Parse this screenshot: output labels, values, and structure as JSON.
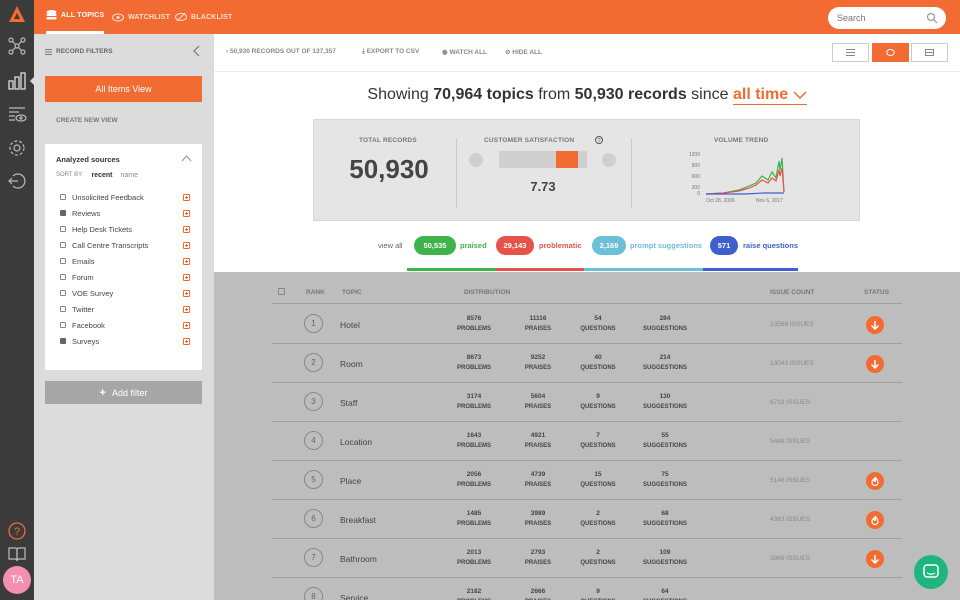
{
  "topbar": {
    "nav": [
      "ALL TOPICS",
      "WATCHLIST",
      "BLACKLIST"
    ],
    "search_placeholder": "Search"
  },
  "sidebar": {
    "avatar_initials": "TA",
    "icons": [
      "nodes-icon",
      "bar-chart-icon",
      "watch-list-icon",
      "gear-icon",
      "logout-icon",
      "help-icon",
      "book-icon"
    ]
  },
  "filters": {
    "header": "RECORD FILTERS",
    "all_items": "All Items View",
    "create_view": "CREATE NEW VIEW",
    "sources_title": "Analyzed sources",
    "sort_by": "SORT BY:",
    "sort_recent": "recent",
    "sort_name": "name",
    "sources": [
      {
        "label": "Unsolicited Feedback",
        "checked": false
      },
      {
        "label": "Reviews",
        "checked": true
      },
      {
        "label": "Help Desk Tickets",
        "checked": false
      },
      {
        "label": "Call Centre Transcripts",
        "checked": false
      },
      {
        "label": "Emails",
        "checked": false
      },
      {
        "label": "Forum",
        "checked": false
      },
      {
        "label": "VOE Survey",
        "checked": false
      },
      {
        "label": "Twitter",
        "checked": false
      },
      {
        "label": "Facebook",
        "checked": false
      },
      {
        "label": "Surveys",
        "checked": true
      }
    ],
    "add_filter": "Add filter"
  },
  "toolbar": {
    "records": "50,930 RECORDS OUT OF 137,357",
    "export": "EXPORT TO CSV",
    "watch_all": "WATCH ALL",
    "hide_all": "HIDE ALL"
  },
  "headline": {
    "prefix": "Showing",
    "topics": "70,964 topics",
    "from": "from",
    "records": "50,930 records",
    "since": "since",
    "period": "all time"
  },
  "stats": {
    "total_label": "TOTAL RECORDS",
    "total_value": "50,930",
    "csat_label": "CUSTOMER SATISFACTION",
    "csat_value": "7.73",
    "csat_level": 0.773,
    "trend_label": "VOLUME TREND",
    "trend_y_ticks": [
      "1200",
      "900",
      "600",
      "300",
      "0"
    ],
    "trend_x_ticks": [
      "Oct 28, 2006",
      "Nov 6, 2017"
    ]
  },
  "pills": {
    "view_all": "view all",
    "items": [
      {
        "value": "50,535",
        "label": "praised",
        "color": "#3db34a"
      },
      {
        "value": "29,143",
        "label": "problematic",
        "color": "#e5534b"
      },
      {
        "value": "2,169",
        "label": "prompt suggestions",
        "color": "#6bbfd6"
      },
      {
        "value": "571",
        "label": "raise questions",
        "color": "#3f5fcf"
      }
    ]
  },
  "table": {
    "headers": {
      "rank": "RANK",
      "topic": "TOPIC",
      "distribution": "DISTRIBUTION",
      "issue_count": "ISSUE COUNT",
      "status": "STATUS"
    },
    "dist_labels": [
      "PROBLEMS",
      "PRAISES",
      "QUESTIONS",
      "SUGGESTIONS"
    ],
    "rows": [
      {
        "rank": "1",
        "topic": "Hotel",
        "problems": "8576",
        "praises": "11116",
        "questions": "54",
        "suggestions": "284",
        "issues": "13569 ISSUES",
        "status": "arrow"
      },
      {
        "rank": "2",
        "topic": "Room",
        "problems": "8673",
        "praises": "9252",
        "questions": "40",
        "suggestions": "214",
        "issues": "13043 ISSUES",
        "status": "arrow"
      },
      {
        "rank": "3",
        "topic": "Staff",
        "problems": "3174",
        "praises": "5604",
        "questions": "9",
        "suggestions": "130",
        "issues": "6719 ISSUES",
        "status": "none"
      },
      {
        "rank": "4",
        "topic": "Location",
        "problems": "1643",
        "praises": "4921",
        "questions": "7",
        "suggestions": "55",
        "issues": "5448 ISSUES",
        "status": "none"
      },
      {
        "rank": "5",
        "topic": "Place",
        "problems": "2056",
        "praises": "4739",
        "questions": "15",
        "suggestions": "75",
        "issues": "5146 ISSUES",
        "status": "fire"
      },
      {
        "rank": "6",
        "topic": "Breakfast",
        "problems": "1485",
        "praises": "3989",
        "questions": "2",
        "suggestions": "68",
        "issues": "4363 ISSUES",
        "status": "fire"
      },
      {
        "rank": "7",
        "topic": "Bathroom",
        "problems": "2013",
        "praises": "2793",
        "questions": "2",
        "suggestions": "109",
        "issues": "3869 ISSUES",
        "status": "arrow"
      },
      {
        "rank": "8",
        "topic": "Service",
        "problems": "2182",
        "praises": "2666",
        "questions": "9",
        "suggestions": "64",
        "issues": "",
        "status": "none"
      }
    ]
  }
}
